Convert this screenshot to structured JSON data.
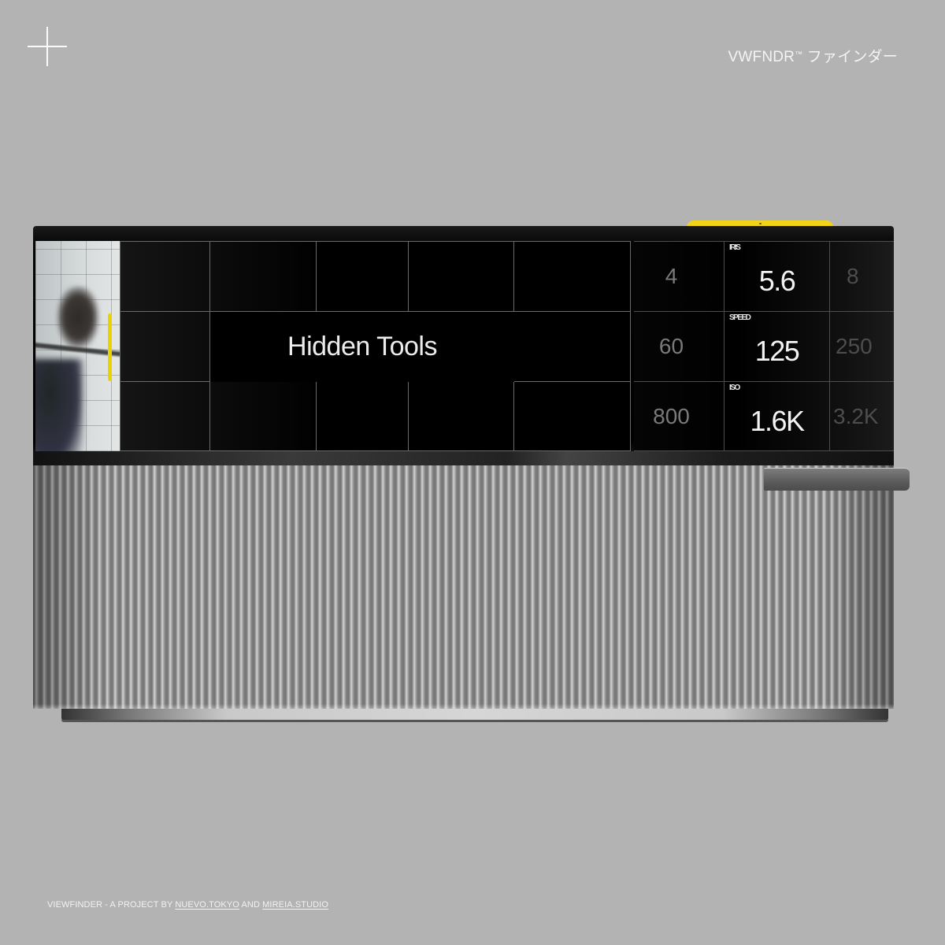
{
  "header": {
    "logo_icon": "plus-icon",
    "brand": "VWFNDR",
    "brand_mark": "™",
    "brand_japanese": "ファインダー"
  },
  "device": {
    "screen_title": "Hidden Tools",
    "accent_color": "#f1d417",
    "photo_alt": "blurred person in front of tiled wall",
    "dials": [
      {
        "label": "IRIS",
        "prev": "4",
        "value": "5.6",
        "next": "8"
      },
      {
        "label": "SPEED",
        "prev": "60",
        "value": "125",
        "next": "250"
      },
      {
        "label": "ISO",
        "prev": "800",
        "value": "1.6K",
        "next": "3.2K"
      }
    ]
  },
  "footer": {
    "prefix": "VIEWFINDER - A PROJECT BY ",
    "link1": "NUEVO.TOKYO",
    "middle": " AND ",
    "link2": "MIREIA.STUDIO"
  }
}
